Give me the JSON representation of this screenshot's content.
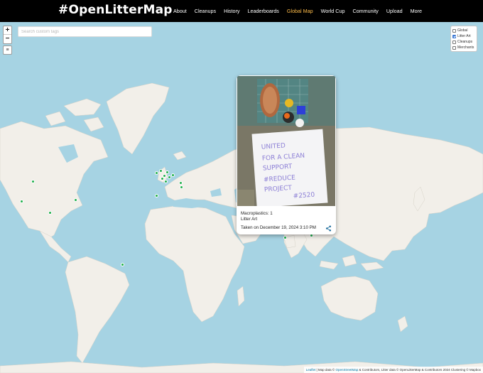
{
  "header": {
    "brand": "#OpenLitterMap",
    "nav": [
      "About",
      "Cleanups",
      "History",
      "Leaderboards",
      "Global Map",
      "World Cup",
      "Community",
      "Upload",
      "More"
    ],
    "active_index": 4,
    "active_color": "#ffbd4a"
  },
  "map": {
    "zoom_in": "+",
    "zoom_out": "−",
    "menu_icon": "≡",
    "search_placeholder": "Search custom tags",
    "layers": [
      {
        "label": "Global",
        "checked": false
      },
      {
        "label": "Litter Art",
        "checked": true
      },
      {
        "label": "Cleanups",
        "checked": false
      },
      {
        "label": "Merchants",
        "checked": false
      }
    ],
    "marker_color": "#1fb04b"
  },
  "popup": {
    "line1": "Macroplastics: 1",
    "line2": "Litter Art",
    "date": "Taken on December 19, 2024 3:10 PM",
    "share_icon": "share-icon"
  },
  "attribution": {
    "leaflet": "Leaflet",
    "sep1": " | Map data © ",
    "osm": "OpenStreetMap",
    "rest": " & Contributors, Litter data © OpenLitterMap & Contributors 2024 Clustering © Mapbox"
  }
}
